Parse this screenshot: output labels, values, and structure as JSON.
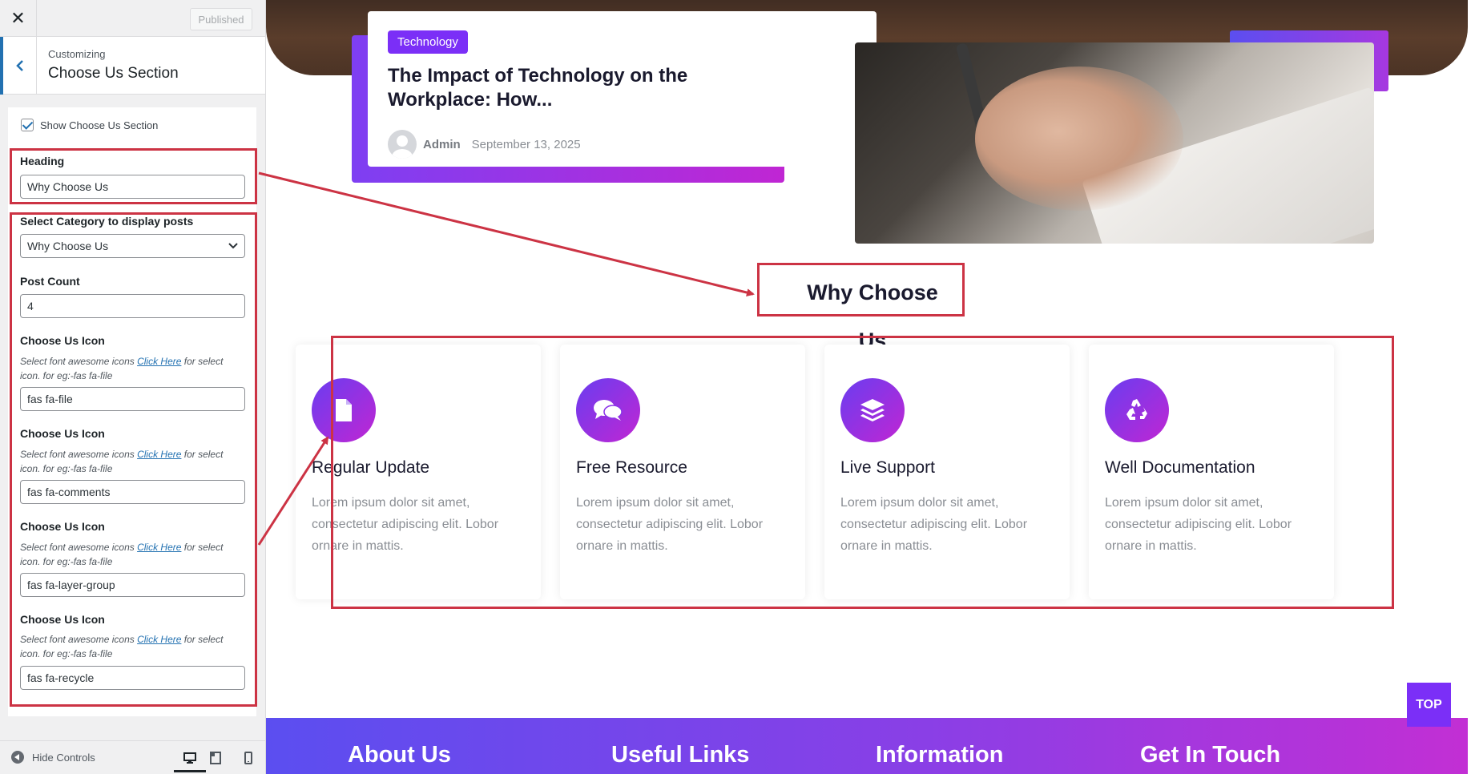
{
  "customizer": {
    "close_label": "✕",
    "publish_label": "Published",
    "breadcrumb_small": "Customizing",
    "breadcrumb_title": "Choose Us Section",
    "show_section_label": "Show Choose Us Section",
    "show_section_checked": true,
    "heading_label": "Heading",
    "heading_value": "Why Choose Us",
    "category_label": "Select Category to display posts",
    "category_value": "Why Choose Us",
    "post_count_label": "Post Count",
    "post_count_value": "4",
    "icon_fields": [
      {
        "label": "Choose Us Icon",
        "desc_before": "Select font awesome icons ",
        "link": "Click Here",
        "desc_after": " for select icon. for eg:-fas fa-file",
        "value": "fas fa-file"
      },
      {
        "label": "Choose Us Icon",
        "desc_before": "Select font awesome icons ",
        "link": "Click Here",
        "desc_after": " for select icon. for eg:-fas fa-file",
        "value": "fas fa-comments"
      },
      {
        "label": "Choose Us Icon",
        "desc_before": "Select font awesome icons ",
        "link": "Click Here",
        "desc_after": " for select icon. for eg:-fas fa-file",
        "value": "fas fa-layer-group"
      },
      {
        "label": "Choose Us Icon",
        "desc_before": "Select font awesome icons ",
        "link": "Click Here",
        "desc_after": " for select icon. for eg:-fas fa-file",
        "value": "fas fa-recycle"
      }
    ],
    "hide_controls_label": "Hide Controls"
  },
  "post": {
    "tag": "Technology",
    "title": "The Impact of Technology on the Workplace: How...",
    "author": "Admin",
    "date": "September 13, 2025"
  },
  "section": {
    "heading": "Why Choose Us",
    "features": [
      {
        "icon": "file-icon",
        "title": "Regular Update",
        "text": "Lorem ipsum dolor sit amet, consectetur adipiscing elit. Lobor ornare in mattis."
      },
      {
        "icon": "comments-icon",
        "title": "Free Resource",
        "text": "Lorem ipsum dolor sit amet, consectetur adipiscing elit. Lobor ornare in mattis."
      },
      {
        "icon": "layer-group-icon",
        "title": "Live Support",
        "text": "Lorem ipsum dolor sit amet, consectetur adipiscing elit. Lobor ornare in mattis."
      },
      {
        "icon": "recycle-icon",
        "title": "Well Documentation",
        "text": "Lorem ipsum dolor sit amet, consectetur adipiscing elit. Lobor ornare in mattis."
      }
    ]
  },
  "top_button": "TOP",
  "footer": {
    "headings": [
      "About Us",
      "Useful Links",
      "Information",
      "Get In Touch"
    ]
  },
  "colors": {
    "annotation_red": "#cc3344",
    "accent_purple": "#7b2ff7",
    "wp_blue": "#2271b1"
  }
}
